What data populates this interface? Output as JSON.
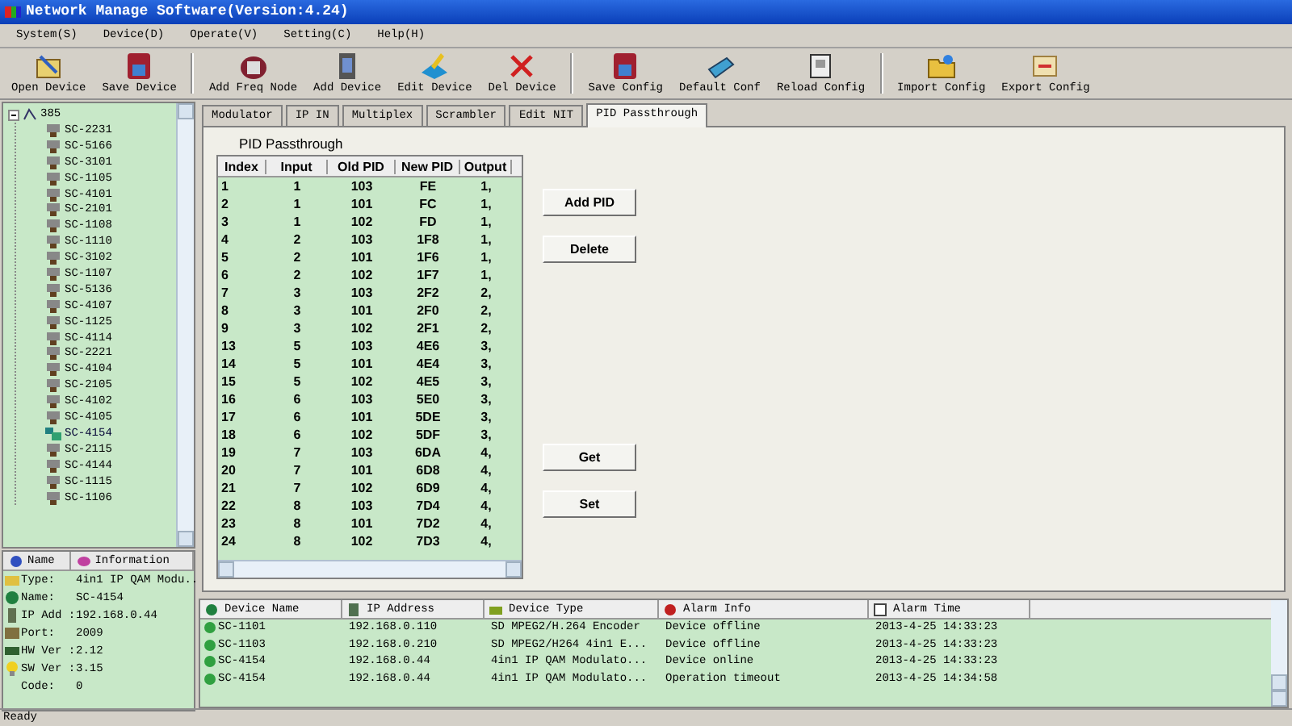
{
  "window": {
    "title": "Network Manage Software(Version:4.24)"
  },
  "menu": [
    "System(S)",
    "Device(D)",
    "Operate(V)",
    "Setting(C)",
    "Help(H)"
  ],
  "toolbar": [
    {
      "label": "Open Device",
      "kind": "open"
    },
    {
      "label": "Save Device",
      "kind": "save"
    },
    {
      "label": "Add Freq Node",
      "kind": "node",
      "group_start": true
    },
    {
      "label": "Add Device",
      "kind": "device"
    },
    {
      "label": "Edit Device",
      "kind": "edit"
    },
    {
      "label": "Del Device",
      "kind": "delete"
    },
    {
      "label": "Save Config",
      "kind": "save",
      "group_start": true
    },
    {
      "label": "Default Conf",
      "kind": "scanner"
    },
    {
      "label": "Reload Config",
      "kind": "reload"
    },
    {
      "label": "Import Config",
      "kind": "folder",
      "group_start": true
    },
    {
      "label": "Export Config",
      "kind": "export"
    }
  ],
  "tree": {
    "root": "385",
    "children": [
      {
        "label": "SC-2231",
        "online": false
      },
      {
        "label": "SC-5166",
        "online": false
      },
      {
        "label": "SC-3101",
        "online": false
      },
      {
        "label": "SC-1105",
        "online": false
      },
      {
        "label": "SC-4101",
        "online": false
      },
      {
        "label": "SC-2101",
        "online": false
      },
      {
        "label": "SC-1108",
        "online": false
      },
      {
        "label": "SC-1110",
        "online": false
      },
      {
        "label": "SC-3102",
        "online": false
      },
      {
        "label": "SC-1107",
        "online": false
      },
      {
        "label": "SC-5136",
        "online": false
      },
      {
        "label": "SC-4107",
        "online": false
      },
      {
        "label": "SC-1125",
        "online": false
      },
      {
        "label": "SC-4114",
        "online": false
      },
      {
        "label": "SC-2221",
        "online": false
      },
      {
        "label": "SC-4104",
        "online": false
      },
      {
        "label": "SC-2105",
        "online": false
      },
      {
        "label": "SC-4102",
        "online": false
      },
      {
        "label": "SC-4105",
        "online": false
      },
      {
        "label": "SC-4154",
        "online": true
      },
      {
        "label": "SC-2115",
        "online": false
      },
      {
        "label": "SC-4144",
        "online": false
      },
      {
        "label": "SC-1115",
        "online": false
      },
      {
        "label": "SC-1106",
        "online": false
      }
    ]
  },
  "info": {
    "columns": [
      "Name",
      "Information"
    ],
    "rows": [
      {
        "name": "Type:",
        "value": "4in1 IP QAM Modu..",
        "kind": "type"
      },
      {
        "name": "Name:",
        "value": "SC-4154",
        "kind": "name"
      },
      {
        "name": "IP Add :",
        "value": "192.168.0.44",
        "kind": "ip"
      },
      {
        "name": "Port:",
        "value": "2009",
        "kind": "port"
      },
      {
        "name": "HW Ver :",
        "value": "2.12",
        "kind": "hw"
      },
      {
        "name": "SW Ver :",
        "value": "3.15",
        "kind": "sw"
      },
      {
        "name": "Code:",
        "value": "0",
        "kind": "code"
      }
    ]
  },
  "tabs": [
    {
      "label": "Modulator",
      "selected": false
    },
    {
      "label": "IP IN",
      "selected": false
    },
    {
      "label": "Multiplex",
      "selected": false
    },
    {
      "label": "Scrambler",
      "selected": false
    },
    {
      "label": "Edit NIT",
      "selected": false
    },
    {
      "label": "PID Passthrough",
      "selected": true
    }
  ],
  "pid_panel": {
    "title": "PID Passthrough",
    "columns": [
      "Index",
      "Input",
      "Old PID",
      "New PID",
      "Output"
    ],
    "rows": [
      [
        "1",
        "1",
        "103",
        "FE",
        "1,"
      ],
      [
        "2",
        "1",
        "101",
        "FC",
        "1,"
      ],
      [
        "3",
        "1",
        "102",
        "FD",
        "1,"
      ],
      [
        "4",
        "2",
        "103",
        "1F8",
        "1,"
      ],
      [
        "5",
        "2",
        "101",
        "1F6",
        "1,"
      ],
      [
        "6",
        "2",
        "102",
        "1F7",
        "1,"
      ],
      [
        "7",
        "3",
        "103",
        "2F2",
        "2,"
      ],
      [
        "8",
        "3",
        "101",
        "2F0",
        "2,"
      ],
      [
        "9",
        "3",
        "102",
        "2F1",
        "2,"
      ],
      [
        "13",
        "5",
        "103",
        "4E6",
        "3,"
      ],
      [
        "14",
        "5",
        "101",
        "4E4",
        "3,"
      ],
      [
        "15",
        "5",
        "102",
        "4E5",
        "3,"
      ],
      [
        "16",
        "6",
        "103",
        "5E0",
        "3,"
      ],
      [
        "17",
        "6",
        "101",
        "5DE",
        "3,"
      ],
      [
        "18",
        "6",
        "102",
        "5DF",
        "3,"
      ],
      [
        "19",
        "7",
        "103",
        "6DA",
        "4,"
      ],
      [
        "20",
        "7",
        "101",
        "6D8",
        "4,"
      ],
      [
        "21",
        "7",
        "102",
        "6D9",
        "4,"
      ],
      [
        "22",
        "8",
        "103",
        "7D4",
        "4,"
      ],
      [
        "23",
        "8",
        "101",
        "7D2",
        "4,"
      ],
      [
        "24",
        "8",
        "102",
        "7D3",
        "4,"
      ]
    ],
    "buttons": [
      "Add PID",
      "Delete",
      "Get",
      "Set"
    ]
  },
  "alarms": {
    "columns": [
      "Device Name",
      "IP Address",
      "Device Type",
      "Alarm Info",
      "Alarm Time"
    ],
    "rows": [
      [
        "SC-1101",
        "192.168.0.110",
        "SD MPEG2/H.264 Encoder",
        "Device offline",
        "2013-4-25 14:33:23"
      ],
      [
        "SC-1103",
        "192.168.0.210",
        "SD MPEG2/H264 4in1 E...",
        "Device offline",
        "2013-4-25 14:33:23"
      ],
      [
        "SC-4154",
        "192.168.0.44",
        "4in1 IP QAM Modulato...",
        "Device online",
        "2013-4-25 14:33:23"
      ],
      [
        "SC-4154",
        "192.168.0.44",
        "4in1 IP QAM Modulato...",
        "Operation timeout",
        "2013-4-25 14:34:58"
      ]
    ]
  },
  "status_bar": "Ready"
}
